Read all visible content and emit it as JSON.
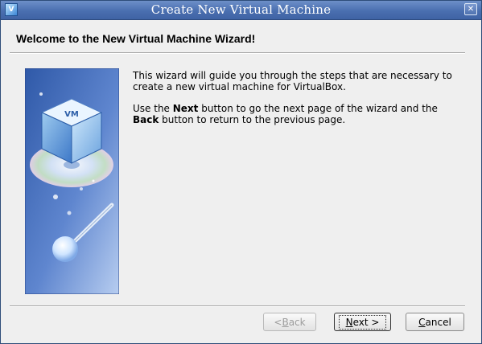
{
  "window": {
    "title": "Create New Virtual Machine"
  },
  "page": {
    "heading": "Welcome to the New Virtual Machine Wizard!"
  },
  "body": {
    "p1": "This wizard will guide you through the steps that are necessary to create a new virtual machine for VirtualBox.",
    "p2_pre": "Use the ",
    "p2_next": "Next",
    "p2_mid": " button to go the next page of the wizard and the ",
    "p2_back": "Back",
    "p2_post": " button to return to the previous page."
  },
  "buttons": {
    "back_prefix": "< ",
    "back_mnemonic": "B",
    "back_rest": "ack",
    "next_mnemonic": "N",
    "next_rest": "ext >",
    "cancel_mnemonic": "C",
    "cancel_rest": "ancel"
  },
  "icons": {
    "app": "virtualbox-icon",
    "close": "close-icon",
    "wizard_art": "virtualbox-cube-illustration"
  },
  "colors": {
    "titlebar": "#4a6fb0",
    "side_panel": "#3b67b5"
  }
}
